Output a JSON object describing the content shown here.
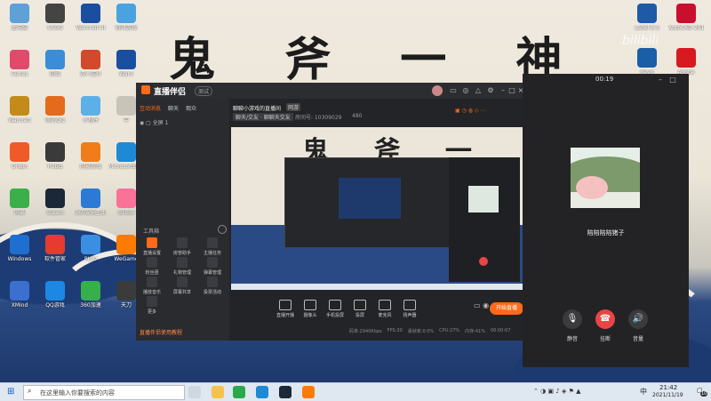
{
  "desktop": {
    "brush_text": "鬼 斧 一 神",
    "icons_left": [
      {
        "label": "此电脑",
        "color": "#5ea0d8"
      },
      {
        "label": "CSGO",
        "color": "#444"
      },
      {
        "label": "Warcraft III",
        "color": "#1a4fa0"
      },
      {
        "label": "腾讯游戏",
        "color": "#4aa3df"
      },
      {
        "label": "iTunes",
        "color": "#e14a6b"
      },
      {
        "label": "网络",
        "color": "#3a8dd8"
      },
      {
        "label": "双人成行",
        "color": "#d4482b"
      },
      {
        "label": "War3",
        "color": "#1a4fa0"
      },
      {
        "label": "Warcraft",
        "color": "#c48b1a"
      },
      {
        "label": "腾讯QQ",
        "color": "#e46b1b"
      },
      {
        "label": "小程序",
        "color": "#5cb0e8"
      },
      {
        "label": "中",
        "color": "#c9c4b8"
      },
      {
        "label": "Origin",
        "color": "#f05a28"
      },
      {
        "label": "PUBG",
        "color": "#3a3a3a"
      },
      {
        "label": "网易游戏",
        "color": "#f07d1a"
      },
      {
        "label": "MicrosoftEdge",
        "color": "#1e8ad6"
      },
      {
        "label": "网易",
        "color": "#3bb04a"
      },
      {
        "label": "Steam",
        "color": "#1b2838"
      },
      {
        "label": "360安全卫士",
        "color": "#2a7ad6"
      },
      {
        "label": "Bilibili",
        "color": "#fb7299"
      },
      {
        "label": "Windows",
        "color": "#1f6fd0"
      },
      {
        "label": "软件管家",
        "color": "#e83a30"
      },
      {
        "label": "PICO",
        "color": "#3b8fe0"
      },
      {
        "label": "WeGame",
        "color": "#ff7a00"
      },
      {
        "label": "XMind",
        "color": "#3b6fd0"
      },
      {
        "label": "QQ游戏",
        "color": "#1d87e4"
      },
      {
        "label": "360加速",
        "color": "#35b04a"
      },
      {
        "label": "天刀",
        "color": "#3b3b3b"
      }
    ],
    "icons_right": [
      {
        "label": "Label 8.5",
        "color": "#1e5aa8"
      },
      {
        "label": "AutoCAD 2019 - 简...",
        "color": "#c8102e"
      },
      {
        "label": "Revit",
        "color": "#1a5ea8"
      },
      {
        "label": "Adobe",
        "color": "#d71920"
      }
    ],
    "watermark": "bilibili"
  },
  "obs": {
    "logo": "直播伴侣",
    "badge": "测试",
    "left_tabs": [
      "互动消息",
      "聊天",
      "观众"
    ],
    "scene_label": "全屏 1",
    "toolbox_title": "工具箱",
    "tools": [
      {
        "label": "直播设置"
      },
      {
        "label": "房管助手"
      },
      {
        "label": "主播任务"
      },
      {
        "label": "粉丝团"
      },
      {
        "label": "礼物管理"
      },
      {
        "label": "弹幕管理"
      },
      {
        "label": "播放音乐"
      },
      {
        "label": "屏幕共享"
      },
      {
        "label": "投票活动"
      },
      {
        "label": "更多"
      }
    ],
    "bottom_note": "直播伴侣使用教程",
    "room_title": "聊聊小游戏的直播间",
    "room_tag": "网游",
    "room_sub": "聊天/交友 · 聊聊天交友",
    "room_id_label": "房间号: 10309029",
    "fans": "480",
    "controls": [
      {
        "label": "直播开播"
      },
      {
        "label": "摄像头"
      },
      {
        "label": "手机投屏"
      },
      {
        "label": "投屏"
      },
      {
        "label": "麦克风"
      },
      {
        "label": "扬声器"
      }
    ],
    "start_button": "开始直播",
    "status": [
      "码率:2940Kbps",
      "FPS:30",
      "丢帧率:0.0%",
      "CPU:27%",
      "内存:41%",
      "00:00:07"
    ]
  },
  "call": {
    "timer": "00:19",
    "caller_name": "陪陪陪陪猪子",
    "mute_label": "静音",
    "hangup_label": "挂断",
    "speaker_label": "音量"
  },
  "taskbar": {
    "search_placeholder": "在这里输入你要搜索的内容",
    "time": "21:42",
    "date": "2021/11/19",
    "ime": "中",
    "badge": "10"
  },
  "colors": {
    "accent": "#ff6a1a",
    "hangup": "#e94545",
    "dark_bg": "#232427"
  }
}
